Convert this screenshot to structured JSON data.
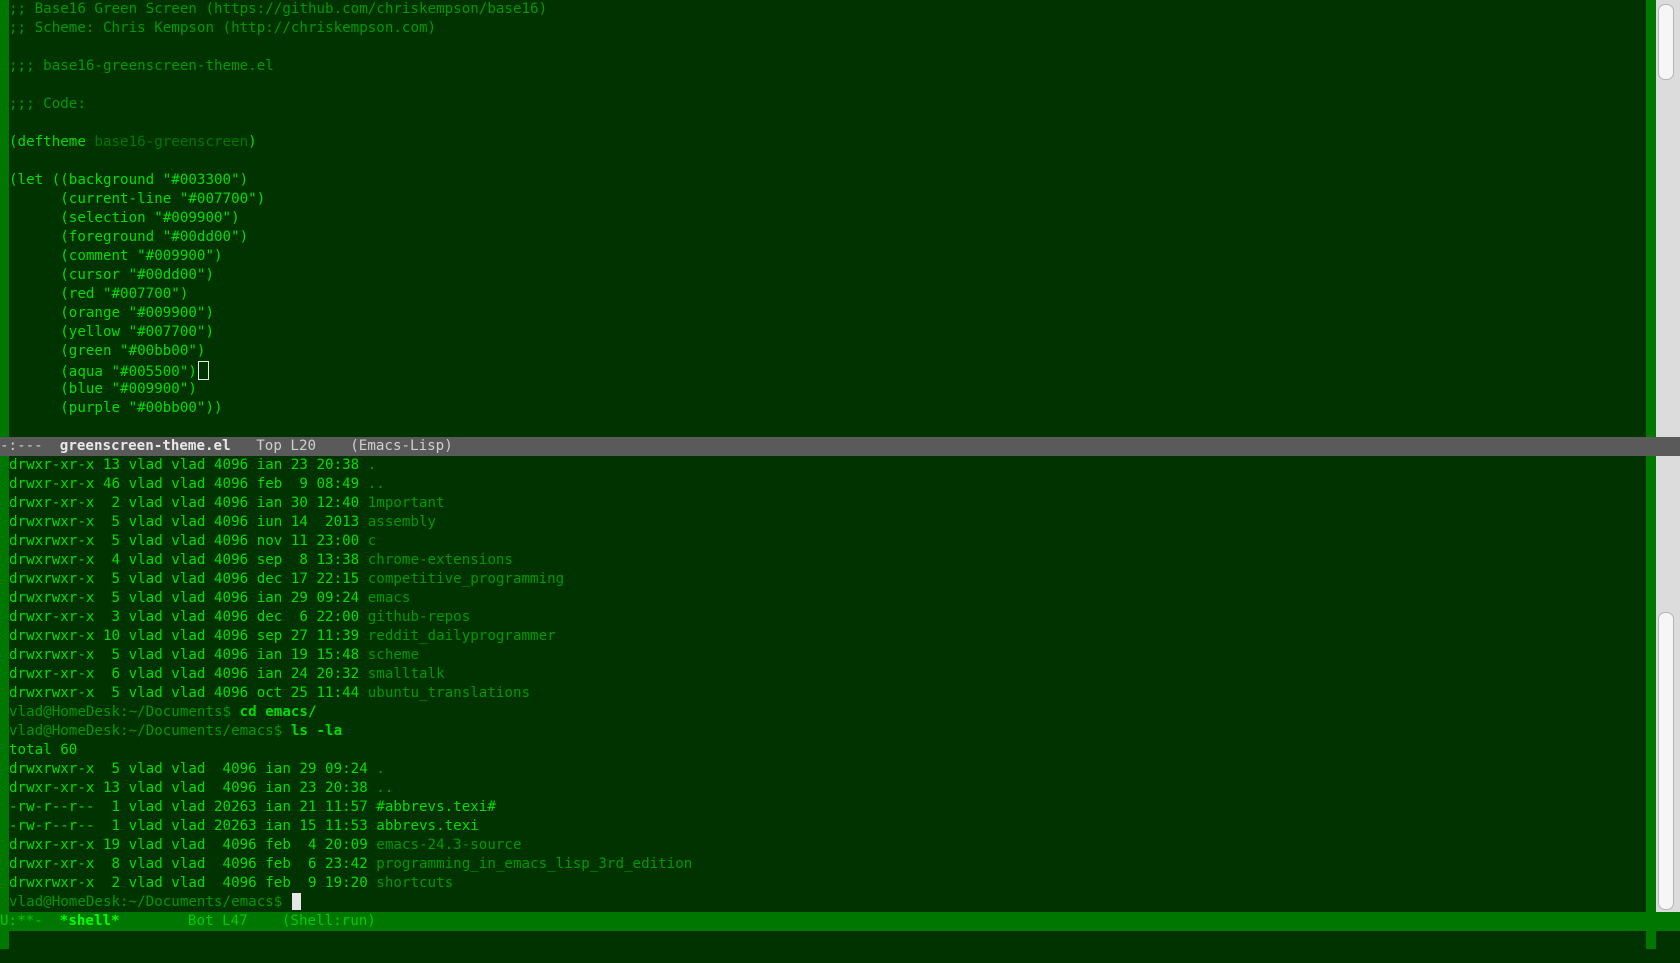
{
  "top_window": {
    "lines": [
      {
        "segments": [
          {
            "text": ";; Base16 Green Screen (https://github.com/chriskempson/base16)",
            "style": "comment"
          }
        ]
      },
      {
        "segments": [
          {
            "text": ";; Scheme: Chris Kempson (http://chriskempson.com)",
            "style": "comment"
          }
        ]
      },
      {
        "segments": [
          {
            "text": "",
            "style": "fg"
          }
        ]
      },
      {
        "segments": [
          {
            "text": ";;; base16-greenscreen-theme.el",
            "style": "comment"
          }
        ]
      },
      {
        "segments": [
          {
            "text": "",
            "style": "fg"
          }
        ]
      },
      {
        "segments": [
          {
            "text": ";;; Code:",
            "style": "comment"
          }
        ]
      },
      {
        "segments": [
          {
            "text": "",
            "style": "fg"
          }
        ]
      },
      {
        "segments": [
          {
            "text": "(deftheme ",
            "style": "fg"
          },
          {
            "text": "base16-greenscreen",
            "style": "name"
          },
          {
            "text": ")",
            "style": "fg"
          }
        ]
      },
      {
        "segments": [
          {
            "text": "",
            "style": "fg"
          }
        ]
      },
      {
        "segments": [
          {
            "text": "(let ((background \"#003300\")",
            "style": "fg"
          }
        ]
      },
      {
        "segments": [
          {
            "text": "      (current-line \"#007700\")",
            "style": "fg"
          }
        ]
      },
      {
        "segments": [
          {
            "text": "      (selection \"#009900\")",
            "style": "fg"
          }
        ]
      },
      {
        "segments": [
          {
            "text": "      (foreground \"#00dd00\")",
            "style": "fg"
          }
        ]
      },
      {
        "segments": [
          {
            "text": "      (comment \"#009900\")",
            "style": "fg"
          }
        ]
      },
      {
        "segments": [
          {
            "text": "      (cursor \"#00dd00\")",
            "style": "fg"
          }
        ]
      },
      {
        "segments": [
          {
            "text": "      (red \"#007700\")",
            "style": "fg"
          }
        ]
      },
      {
        "segments": [
          {
            "text": "      (orange \"#009900\")",
            "style": "fg"
          }
        ]
      },
      {
        "segments": [
          {
            "text": "      (yellow \"#007700\")",
            "style": "fg"
          }
        ]
      },
      {
        "segments": [
          {
            "text": "      (green \"#00bb00\")",
            "style": "fg"
          }
        ]
      },
      {
        "segments": [
          {
            "text": "      (aqua \"#005500\")",
            "style": "fg"
          }
        ],
        "cursor": "box"
      },
      {
        "segments": [
          {
            "text": "      (blue \"#009900\")",
            "style": "fg"
          }
        ]
      },
      {
        "segments": [
          {
            "text": "      (purple \"#00bb00\"))",
            "style": "fg"
          }
        ]
      }
    ]
  },
  "top_modeline": {
    "status": "-:---  ",
    "buffer": "greenscreen-theme.el",
    "position": "   Top L20    ",
    "mode": "(Emacs-Lisp)"
  },
  "shell_window": {
    "lines": [
      {
        "segments": [
          {
            "text": "drwxr-xr-x 13 vlad vlad 4096 ian 23 20:38 ",
            "style": "fg"
          },
          {
            "text": ".",
            "style": "dir"
          }
        ]
      },
      {
        "segments": [
          {
            "text": "drwxr-xr-x 46 vlad vlad 4096 feb  9 08:49 ",
            "style": "fg"
          },
          {
            "text": "..",
            "style": "dir"
          }
        ]
      },
      {
        "segments": [
          {
            "text": "drwxr-xr-x  2 vlad vlad 4096 ian 30 12:40 ",
            "style": "fg"
          },
          {
            "text": "1mportant",
            "style": "dir"
          }
        ]
      },
      {
        "segments": [
          {
            "text": "drwxrwxr-x  5 vlad vlad 4096 iun 14  2013 ",
            "style": "fg"
          },
          {
            "text": "assembly",
            "style": "dir"
          }
        ]
      },
      {
        "segments": [
          {
            "text": "drwxrwxr-x  5 vlad vlad 4096 nov 11 23:00 ",
            "style": "fg"
          },
          {
            "text": "c",
            "style": "dir"
          }
        ]
      },
      {
        "segments": [
          {
            "text": "drwxrwxr-x  4 vlad vlad 4096 sep  8 13:38 ",
            "style": "fg"
          },
          {
            "text": "chrome-extensions",
            "style": "dir"
          }
        ]
      },
      {
        "segments": [
          {
            "text": "drwxrwxr-x  5 vlad vlad 4096 dec 17 22:15 ",
            "style": "fg"
          },
          {
            "text": "competitive_programming",
            "style": "dir"
          }
        ]
      },
      {
        "segments": [
          {
            "text": "drwxrwxr-x  5 vlad vlad 4096 ian 29 09:24 ",
            "style": "fg"
          },
          {
            "text": "emacs",
            "style": "dir"
          }
        ]
      },
      {
        "segments": [
          {
            "text": "drwxr-xr-x  3 vlad vlad 4096 dec  6 22:00 ",
            "style": "fg"
          },
          {
            "text": "github-repos",
            "style": "dir"
          }
        ]
      },
      {
        "segments": [
          {
            "text": "drwxrwxr-x 10 vlad vlad 4096 sep 27 11:39 ",
            "style": "fg"
          },
          {
            "text": "reddit_dailyprogrammer",
            "style": "dir"
          }
        ]
      },
      {
        "segments": [
          {
            "text": "drwxrwxr-x  5 vlad vlad 4096 ian 19 15:48 ",
            "style": "fg"
          },
          {
            "text": "scheme",
            "style": "dir"
          }
        ]
      },
      {
        "segments": [
          {
            "text": "drwxr-xr-x  6 vlad vlad 4096 ian 24 20:32 ",
            "style": "fg"
          },
          {
            "text": "smalltalk",
            "style": "dir"
          }
        ]
      },
      {
        "segments": [
          {
            "text": "drwxrwxr-x  5 vlad vlad 4096 oct 25 11:44 ",
            "style": "fg"
          },
          {
            "text": "ubuntu_translations",
            "style": "dir"
          }
        ]
      },
      {
        "segments": [
          {
            "text": "vlad@HomeDesk:~/Documents$ ",
            "style": "comment"
          },
          {
            "text": "cd emacs/",
            "style": "bold"
          }
        ]
      },
      {
        "segments": [
          {
            "text": "vlad@HomeDesk:~/Documents/emacs$ ",
            "style": "comment"
          },
          {
            "text": "ls -la",
            "style": "bold"
          }
        ]
      },
      {
        "segments": [
          {
            "text": "total 60",
            "style": "fg"
          }
        ]
      },
      {
        "segments": [
          {
            "text": "drwxrwxr-x  5 vlad vlad  4096 ian 29 09:24 ",
            "style": "fg"
          },
          {
            "text": ".",
            "style": "dir"
          }
        ]
      },
      {
        "segments": [
          {
            "text": "drwxr-xr-x 13 vlad vlad  4096 ian 23 20:38 ",
            "style": "fg"
          },
          {
            "text": "..",
            "style": "dir"
          }
        ]
      },
      {
        "segments": [
          {
            "text": "-rw-r--r--  1 vlad vlad 20263 ian 21 11:57 ",
            "style": "fg"
          },
          {
            "text": "#abbrevs.texi#",
            "style": "fg"
          }
        ]
      },
      {
        "segments": [
          {
            "text": "-rw-r--r--  1 vlad vlad 20263 ian 15 11:53 ",
            "style": "fg"
          },
          {
            "text": "abbrevs.texi",
            "style": "fg"
          }
        ]
      },
      {
        "segments": [
          {
            "text": "drwxr-xr-x 19 vlad vlad  4096 feb  4 20:09 ",
            "style": "fg"
          },
          {
            "text": "emacs-24.3-source",
            "style": "dir"
          }
        ]
      },
      {
        "segments": [
          {
            "text": "drwxr-xr-x  8 vlad vlad  4096 feb  6 23:42 ",
            "style": "fg"
          },
          {
            "text": "programming_in_emacs_lisp_3rd_edition",
            "style": "dir"
          }
        ]
      },
      {
        "segments": [
          {
            "text": "drwxrwxr-x  2 vlad vlad  4096 feb  9 19:20 ",
            "style": "fg"
          },
          {
            "text": "shortcuts",
            "style": "dir"
          }
        ]
      },
      {
        "segments": [
          {
            "text": "vlad@HomeDesk:~/Documents/emacs$ ",
            "style": "comment"
          }
        ],
        "cursor": "solid"
      }
    ]
  },
  "bottom_modeline": {
    "status": "U:**-  ",
    "buffer": "*shell*",
    "position": "        Bot L47    ",
    "mode": "(Shell:run)"
  },
  "colors": {
    "background": "#003300",
    "foreground": "#00dd00",
    "comment": "#009900",
    "current_line": "#007700",
    "modeline_inactive": "#5a5a5a"
  }
}
